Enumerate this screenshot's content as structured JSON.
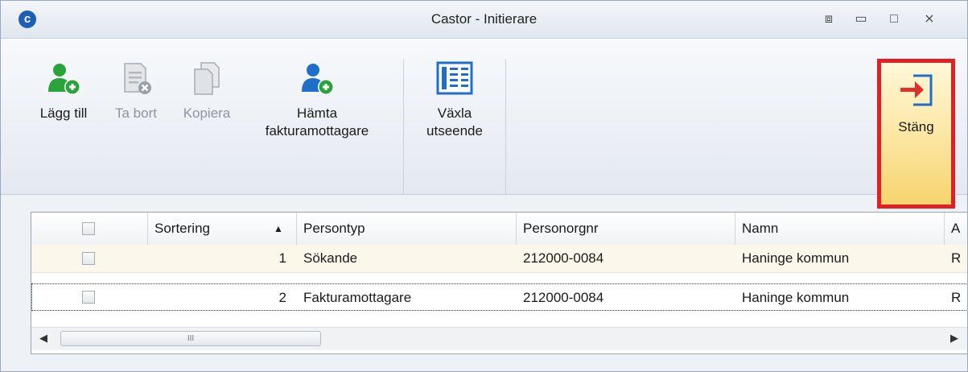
{
  "window": {
    "logo_letter": "c",
    "title": "Castor - Initierare",
    "controls": {
      "restore": "⧈",
      "minimize": "▭",
      "maximize": "□",
      "close": "⨯"
    }
  },
  "toolbar": {
    "add_label": "Lägg till",
    "delete_label": "Ta bort",
    "copy_label": "Kopiera",
    "fetch_label_line1": "Hämta",
    "fetch_label_line2": "fakturamottagare",
    "switch_label_line1": "Växla",
    "switch_label_line2": "utseende",
    "close_label": "Stäng"
  },
  "colors": {
    "add_green": "#2aa33a",
    "person_blue": "#1f6fc8",
    "highlight_red": "#e31e24",
    "close_arrow": "#e0302a"
  },
  "grid": {
    "columns": [
      "Sortering",
      "Persontyp",
      "Personorgnr",
      "Namn",
      "A"
    ],
    "sort_indicator": "▲",
    "rows": [
      {
        "sortering": "1",
        "persontyp": "Sökande",
        "personorgnr": "212000-0084",
        "namn": "Haninge kommun",
        "a": "R"
      },
      {
        "sortering": "2",
        "persontyp": "Fakturamottagare",
        "personorgnr": "212000-0084",
        "namn": "Haninge kommun",
        "a": "R"
      }
    ],
    "scroll": {
      "left": "◀",
      "right": "▶",
      "thumb": "III"
    }
  }
}
